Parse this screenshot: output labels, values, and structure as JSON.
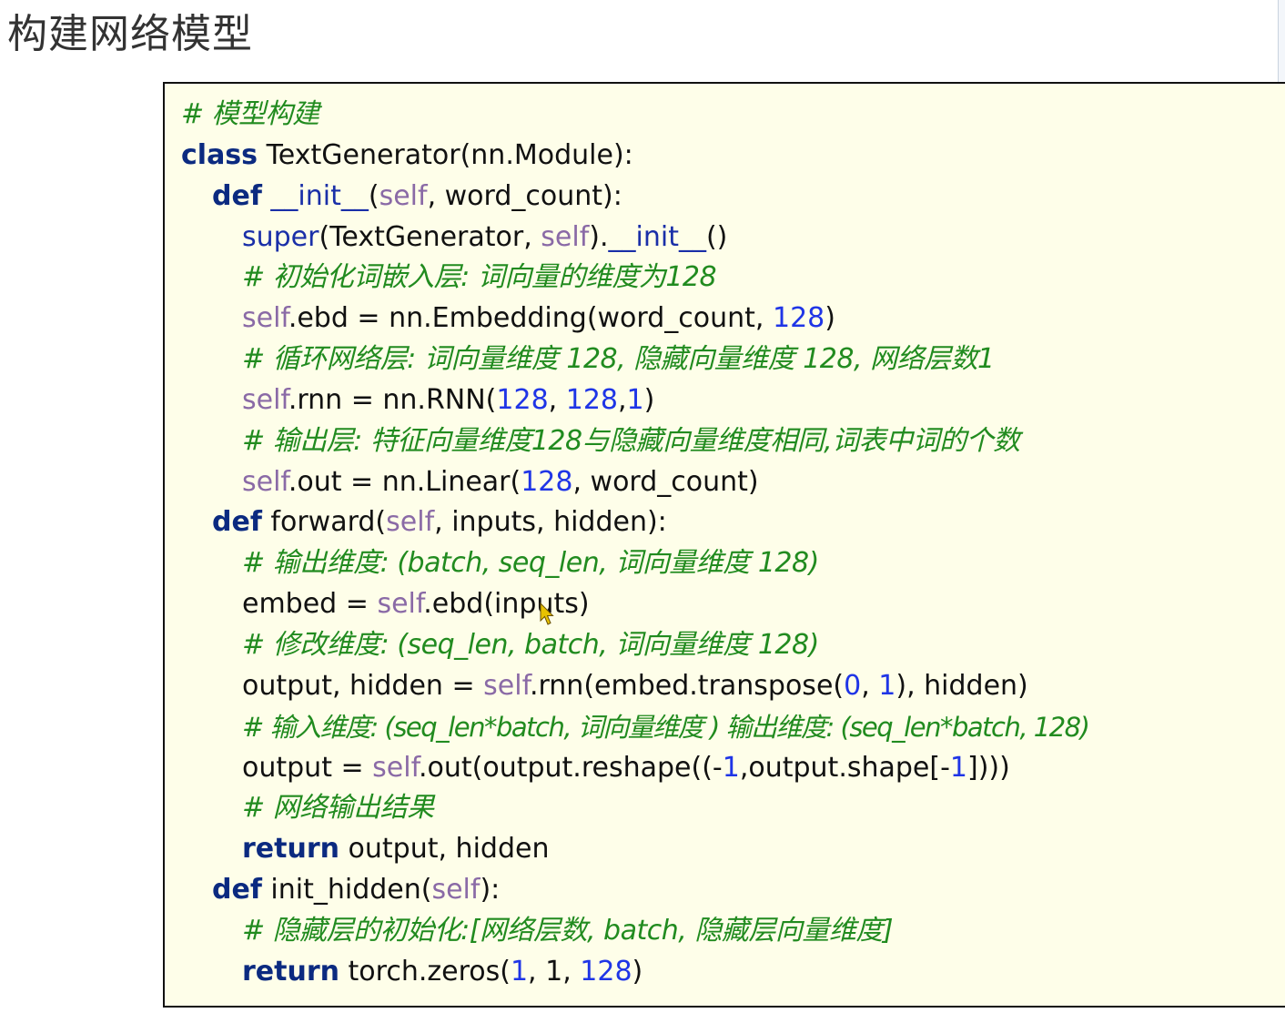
{
  "slide": {
    "title": "构建网络模型"
  },
  "colors": {
    "code_background": "#fefee9",
    "keyword": "#0b2a80",
    "self": "#8a6aa6",
    "number": "#1f35e6",
    "comment": "#218b1f",
    "plain": "#111111",
    "cursor": "#e8c200"
  },
  "code": {
    "lines": [
      {
        "indent": 0,
        "tokens": [
          {
            "t": "comment",
            "v": "# 模型构建"
          }
        ]
      },
      {
        "indent": 0,
        "tokens": [
          {
            "t": "kw",
            "v": "class"
          },
          {
            "t": "plain",
            "v": " TextGenerator(nn.Module):"
          }
        ]
      },
      {
        "indent": 1,
        "tokens": [
          {
            "t": "kw",
            "v": "def"
          },
          {
            "t": "plain",
            "v": " "
          },
          {
            "t": "dunder",
            "v": "__init__"
          },
          {
            "t": "plain",
            "v": "("
          },
          {
            "t": "self",
            "v": "self"
          },
          {
            "t": "plain",
            "v": ", word_count):"
          }
        ]
      },
      {
        "indent": 2,
        "tokens": [
          {
            "t": "builtin",
            "v": "super"
          },
          {
            "t": "plain",
            "v": "(TextGenerator, "
          },
          {
            "t": "self",
            "v": "self"
          },
          {
            "t": "plain",
            "v": ")."
          },
          {
            "t": "dunder",
            "v": "__init__"
          },
          {
            "t": "plain",
            "v": "()"
          }
        ]
      },
      {
        "indent": 2,
        "tokens": [
          {
            "t": "comment",
            "v": "# 初始化词嵌入层: 词向量的维度为128"
          }
        ]
      },
      {
        "indent": 2,
        "tokens": [
          {
            "t": "self",
            "v": "self"
          },
          {
            "t": "plain",
            "v": ".ebd = nn.Embedding(word_count, "
          },
          {
            "t": "num",
            "v": "128"
          },
          {
            "t": "plain",
            "v": ")"
          }
        ]
      },
      {
        "indent": 2,
        "tokens": [
          {
            "t": "comment",
            "v": "# 循环网络层: 词向量维度 128, 隐藏向量维度 128, 网络层数1"
          }
        ]
      },
      {
        "indent": 2,
        "tokens": [
          {
            "t": "self",
            "v": "self"
          },
          {
            "t": "plain",
            "v": ".rnn = nn.RNN("
          },
          {
            "t": "num",
            "v": "128"
          },
          {
            "t": "plain",
            "v": ", "
          },
          {
            "t": "num",
            "v": "128"
          },
          {
            "t": "plain",
            "v": ","
          },
          {
            "t": "num",
            "v": "1"
          },
          {
            "t": "plain",
            "v": ")"
          }
        ]
      },
      {
        "indent": 2,
        "tokens": [
          {
            "t": "comment",
            "v": "# 输出层: 特征向量维度128与隐藏向量维度相同,词表中词的个数"
          }
        ]
      },
      {
        "indent": 2,
        "tokens": [
          {
            "t": "self",
            "v": "self"
          },
          {
            "t": "plain",
            "v": ".out = nn.Linear("
          },
          {
            "t": "num",
            "v": "128"
          },
          {
            "t": "plain",
            "v": ", word_count)"
          }
        ]
      },
      {
        "indent": 1,
        "tokens": [
          {
            "t": "kw",
            "v": "def"
          },
          {
            "t": "plain",
            "v": " forward("
          },
          {
            "t": "self",
            "v": "self"
          },
          {
            "t": "plain",
            "v": ", inputs, hidden):"
          }
        ]
      },
      {
        "indent": 2,
        "tokens": [
          {
            "t": "comment",
            "v": "# 输出维度: (batch, seq_len, 词向量维度 128)"
          }
        ]
      },
      {
        "indent": 2,
        "tokens": [
          {
            "t": "plain",
            "v": "embed = "
          },
          {
            "t": "self",
            "v": "self"
          },
          {
            "t": "plain",
            "v": ".ebd(inputs)"
          }
        ]
      },
      {
        "indent": 2,
        "tokens": [
          {
            "t": "comment",
            "v": "# 修改维度: (seq_len, batch, 词向量维度 128)"
          }
        ]
      },
      {
        "indent": 2,
        "tokens": [
          {
            "t": "plain",
            "v": "output, hidden = "
          },
          {
            "t": "self",
            "v": "self"
          },
          {
            "t": "plain",
            "v": ".rnn(embed.transpose("
          },
          {
            "t": "num",
            "v": "0"
          },
          {
            "t": "plain",
            "v": ", "
          },
          {
            "t": "num",
            "v": "1"
          },
          {
            "t": "plain",
            "v": "), hidden)"
          }
        ]
      },
      {
        "indent": 2,
        "tokens": [
          {
            "t": "comment",
            "v": "# 输入维度: (seq_len*batch, 词向量维度 ) 输出维度: (seq_len*batch, 128)"
          }
        ]
      },
      {
        "indent": 2,
        "tokens": [
          {
            "t": "plain",
            "v": "output = "
          },
          {
            "t": "self",
            "v": "self"
          },
          {
            "t": "plain",
            "v": ".out(output.reshape((-"
          },
          {
            "t": "num",
            "v": "1"
          },
          {
            "t": "plain",
            "v": ",output.shape[-"
          },
          {
            "t": "num",
            "v": "1"
          },
          {
            "t": "plain",
            "v": "])))"
          }
        ]
      },
      {
        "indent": 2,
        "tokens": [
          {
            "t": "comment",
            "v": "# 网络输出结果"
          }
        ]
      },
      {
        "indent": 2,
        "tokens": [
          {
            "t": "kw",
            "v": "return"
          },
          {
            "t": "plain",
            "v": " output, hidden"
          }
        ]
      },
      {
        "indent": 1,
        "tokens": [
          {
            "t": "kw",
            "v": "def"
          },
          {
            "t": "plain",
            "v": " init_hidden("
          },
          {
            "t": "self",
            "v": "self"
          },
          {
            "t": "plain",
            "v": "):"
          }
        ]
      },
      {
        "indent": 2,
        "tokens": [
          {
            "t": "comment",
            "v": "# 隐藏层的初始化:[网络层数, batch, 隐藏层向量维度]"
          }
        ]
      },
      {
        "indent": 2,
        "tokens": [
          {
            "t": "kw",
            "v": "return"
          },
          {
            "t": "plain",
            "v": " torch.zeros("
          },
          {
            "t": "num",
            "v": "1"
          },
          {
            "t": "plain",
            "v": ", 1, "
          },
          {
            "t": "num",
            "v": "128"
          },
          {
            "t": "plain",
            "v": ")"
          }
        ]
      }
    ]
  },
  "icons": {
    "cursor": "mouse-pointer-icon"
  }
}
